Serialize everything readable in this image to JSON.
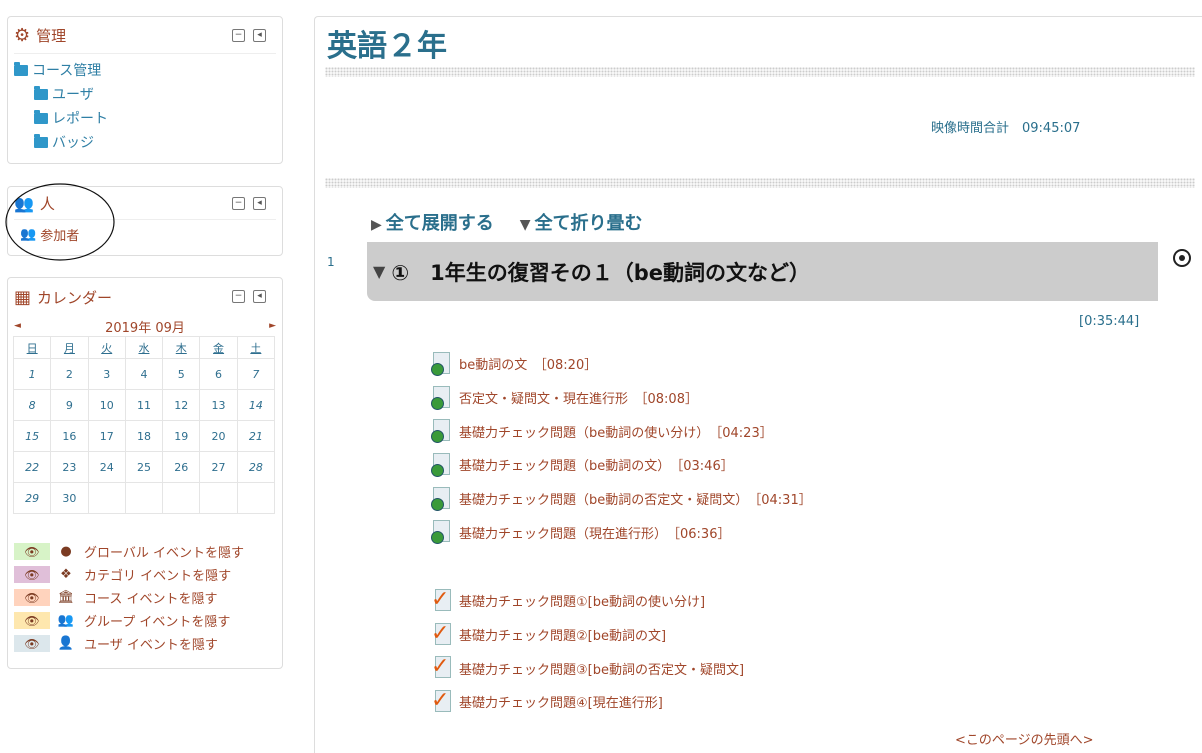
{
  "admin_block": {
    "title": "管理",
    "course_admin": "コース管理",
    "items": [
      "ユーザ",
      "レポート",
      "バッジ"
    ]
  },
  "people_block": {
    "title": "人",
    "participants": "参加者"
  },
  "calendar_block": {
    "title": "カレンダー",
    "month": "2019年 09月",
    "prev": "◄",
    "next": "►",
    "weekdays": [
      "日",
      "月",
      "火",
      "水",
      "木",
      "金",
      "土"
    ],
    "weeks": [
      [
        "1",
        "2",
        "3",
        "4",
        "5",
        "6",
        "7"
      ],
      [
        "8",
        "9",
        "10",
        "11",
        "12",
        "13",
        "14"
      ],
      [
        "15",
        "16",
        "17",
        "18",
        "19",
        "20",
        "21"
      ],
      [
        "22",
        "23",
        "24",
        "25",
        "26",
        "27",
        "28"
      ],
      [
        "29",
        "30",
        "",
        "",
        "",
        "",
        ""
      ]
    ],
    "legend": [
      {
        "label": "グローバル イベントを隠す",
        "color": "#d7f3c7",
        "icon": "globe-icon",
        "glyph": "●"
      },
      {
        "label": "カテゴリ イベントを隠す",
        "color": "#e0bfd9",
        "icon": "category-icon",
        "glyph": "❖"
      },
      {
        "label": "コース イベントを隠す",
        "color": "#ffd3bd",
        "icon": "course-icon",
        "glyph": "🏛"
      },
      {
        "label": "グループ イベントを隠す",
        "color": "#fee7ae",
        "icon": "group-icon",
        "glyph": "👥"
      },
      {
        "label": "ユーザ イベントを隠す",
        "color": "#dce7ec",
        "icon": "user-icon",
        "glyph": "👤"
      }
    ]
  },
  "main": {
    "course_title": "英語２年",
    "total_label": "映像時間合計　09:45:07",
    "expand_all": "全て展開する",
    "collapse_all": "全て折り畳む",
    "section_number": "1",
    "section_title": "①　1年生の復習その１（be動詞の文など）",
    "section_time": "[0:35:44]",
    "pages": [
      "be動詞の文　［08:20］",
      "否定文・疑問文・現在進行形　［08:08］",
      "基礎力チェック問題（be動詞の使い分け）　［04:23］",
      "基礎力チェック問題（be動詞の文）　［03:46］",
      "基礎力チェック問題（be動詞の否定文・疑問文）　［04:31］",
      "基礎力チェック問題（現在進行形）　［06:36］"
    ],
    "quizzes": [
      "基礎力チェック問題①[be動詞の使い分け]",
      "基礎力チェック問題②[be動詞の文]",
      "基礎力チェック問題③[be動詞の否定文・疑問文]",
      "基礎力チェック問題④[現在進行形]"
    ],
    "top_link": "<このページの先頭へ>"
  },
  "colors": {
    "accent": "#2a6f8c",
    "link": "#a0462a",
    "section_bg": "#cccccc"
  }
}
